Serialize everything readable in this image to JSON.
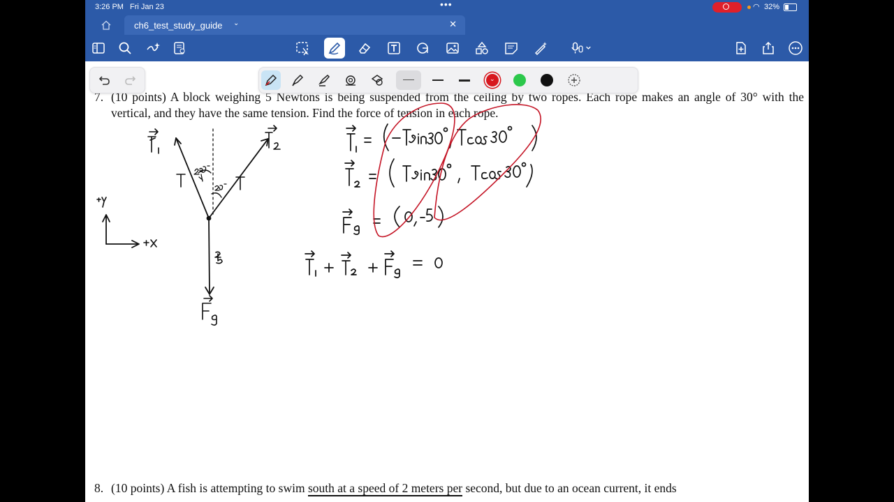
{
  "status": {
    "time": "3:26 PM",
    "date": "Fri Jan 23",
    "battery": "32%"
  },
  "tab": {
    "title": "ch6_test_study_guide"
  },
  "toolbar": {
    "left_icons": [
      "sidebar-icon",
      "search-icon",
      "magic-icon",
      "page-icon"
    ],
    "tools": [
      "lasso-icon",
      "pen-icon",
      "eraser-icon",
      "text-icon",
      "shapes-icon",
      "image-icon",
      "elements-icon",
      "sticky-note-icon",
      "laser-icon",
      "mic-icon"
    ],
    "right_icons": [
      "add-page-icon",
      "share-icon",
      "more-icon"
    ]
  },
  "penbar": {
    "tools": [
      "fountain-pen-icon",
      "ball-pen-icon",
      "brush-pen-icon",
      "highlighter-icon",
      "pencil-shape-icon"
    ],
    "colors": [
      "#d7171e",
      "#2cc84b",
      "#111111"
    ]
  },
  "problems": {
    "p7": {
      "number": "7.",
      "text": "(10 points)  A block weighing 5 Newtons is being suspended from the ceiling by two ropes. Each rope makes an angle of 30° with the vertical, and they have the same tension. Find the force of tension in each rope."
    },
    "p8": {
      "number": "8.",
      "text_before": "(10 points)  A fish is attempting to swim ",
      "underlined": "south at a speed of 2 meters per",
      "text_after": " second, but due to an ocean current, it ends"
    }
  }
}
